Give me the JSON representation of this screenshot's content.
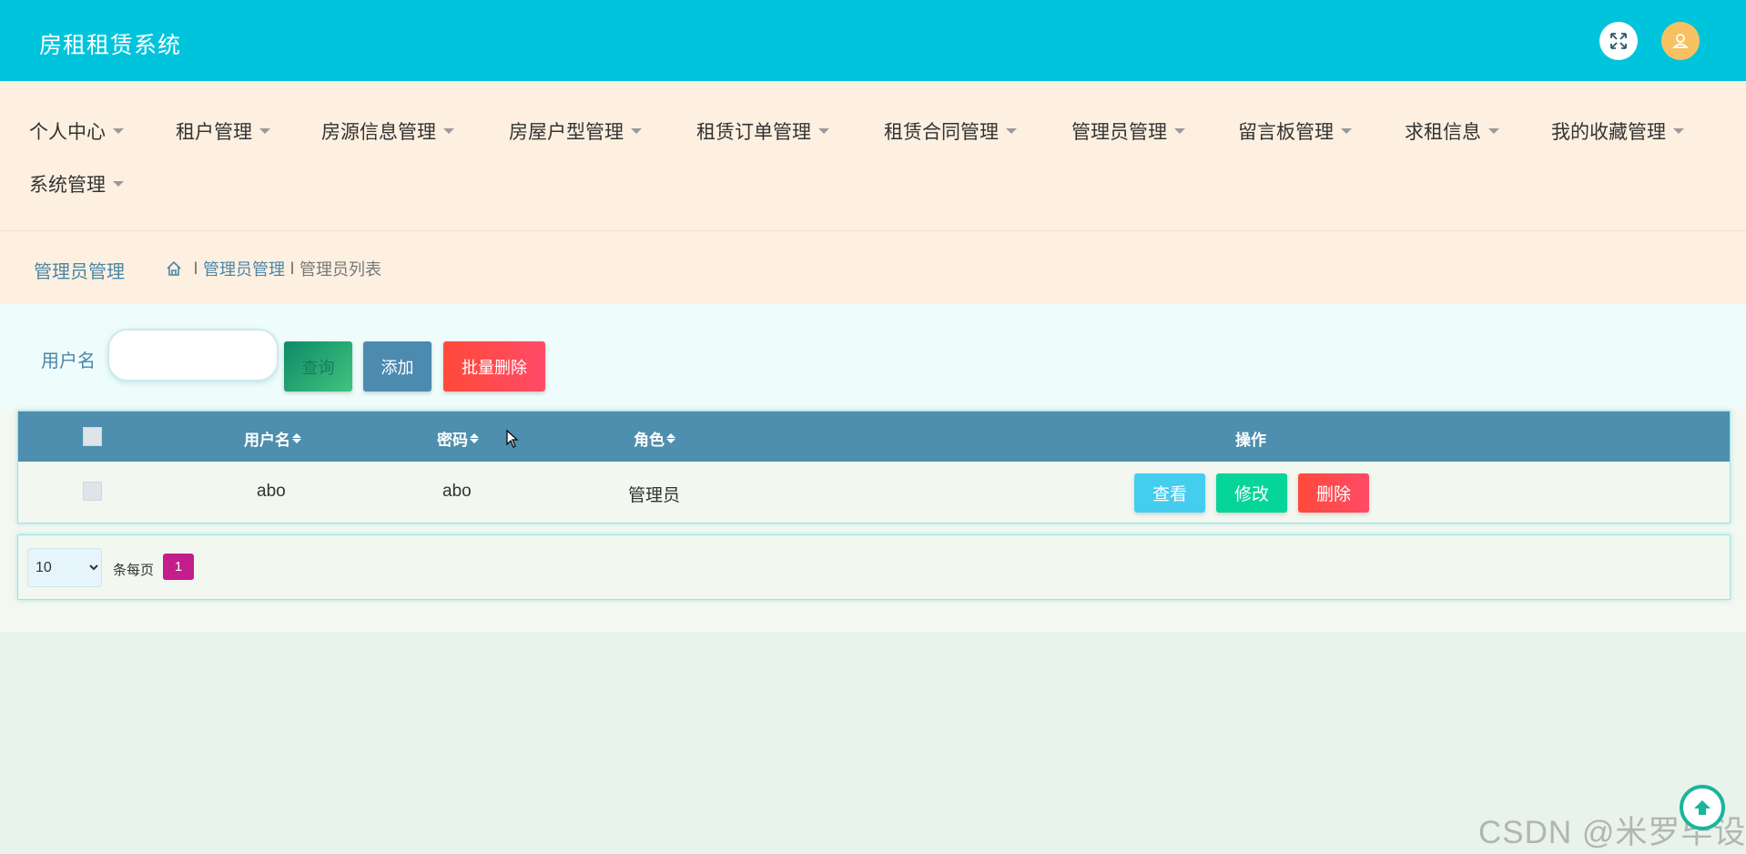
{
  "header": {
    "title": "房租租赁系统",
    "fullscreen_icon": "expand-icon",
    "avatar_icon": "user-icon",
    "bg_color": "#00c4dc"
  },
  "nav": {
    "items": [
      {
        "label": "个人中心"
      },
      {
        "label": "租户管理"
      },
      {
        "label": "房源信息管理"
      },
      {
        "label": "房屋户型管理"
      },
      {
        "label": "租赁订单管理"
      },
      {
        "label": "租赁合同管理"
      },
      {
        "label": "管理员管理"
      },
      {
        "label": "留言板管理"
      },
      {
        "label": "求租信息"
      },
      {
        "label": "我的收藏管理"
      },
      {
        "label": "系统管理"
      }
    ]
  },
  "breadcrumb": {
    "title": "管理员管理",
    "home_icon": "home-icon",
    "items": [
      "管理员管理",
      "管理员列表"
    ],
    "separator": "l"
  },
  "search": {
    "label": "用户名",
    "value": "",
    "placeholder": "",
    "query_label": "查询",
    "add_label": "添加",
    "batch_delete_label": "批量删除"
  },
  "table": {
    "columns": [
      "用户名",
      "密码",
      "角色",
      "操作"
    ],
    "rows": [
      {
        "username": "abo",
        "password": "abo",
        "role": "管理员"
      }
    ],
    "actions": {
      "view": "查看",
      "edit": "修改",
      "delete": "删除"
    }
  },
  "pagination": {
    "page_size": "10",
    "page_size_options": [
      "10"
    ],
    "per_page_label": "条每页",
    "current_page": "1"
  },
  "watermark": "CSDN @米罗毕设",
  "colors": {
    "accent": "#00c4dc",
    "table_header": "#4e8eae",
    "danger": "#ff4a3a",
    "success": "#05d598",
    "info": "#45cdf0",
    "page_active": "#c41d8c"
  }
}
